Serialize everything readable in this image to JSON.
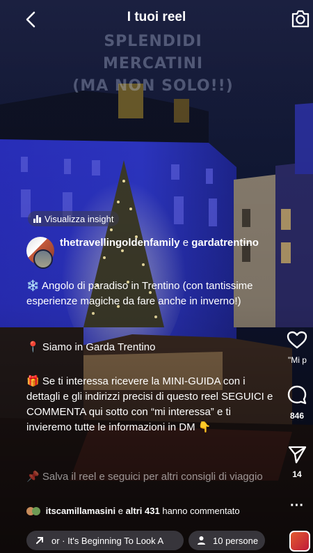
{
  "header": {
    "title": "I tuoi reel"
  },
  "video_overlay": {
    "line1": "SPLENDIDI MERCATINI",
    "line2": "(MA NON SOLO!!)"
  },
  "insight": {
    "label": "Visualizza insight"
  },
  "post": {
    "author": "thetravellingoldenfamily",
    "connector": "e",
    "coauthor": "gardatrentino",
    "caption": {
      "p1": "❄️ Angolo di paradiso in Trentino (con tantissime esperienze magiche da fare anche in inverno!)",
      "p2": "📍 Siamo in Garda Trentino",
      "p3": "🎁 Se ti interessa ricevere la MINI-GUIDA con i dettagli e gli indirizzi precisi di questo reel SEGUICI e COMMENTA qui sotto con “mi interessa” e ti invieremo tutte le informazioni in DM 👇",
      "p4": "📌 Salva il reel e seguici per altri consigli di viaggio"
    }
  },
  "comments_summary": {
    "user": "itscamillamasini",
    "middle": "e",
    "others": "altri 431",
    "suffix": "hanno commentato"
  },
  "music": {
    "label": "or · It's Beginning To Look A"
  },
  "people": {
    "label": "10 persone"
  },
  "actions": {
    "likes_label": "\"Mi p",
    "comments_count": "846",
    "shares_count": "14"
  },
  "colors": {
    "night_sky": "#0a0f2a",
    "building_blue": "#2a33c8",
    "tree_light": "#f6e7a8"
  }
}
